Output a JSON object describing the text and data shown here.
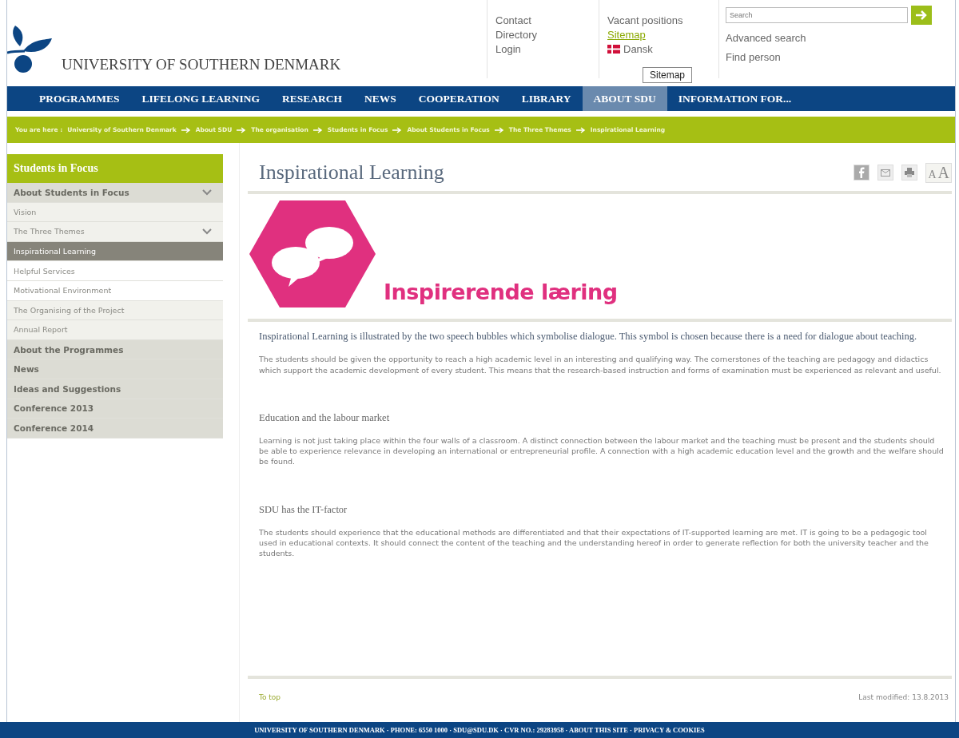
{
  "header": {
    "logo_text": "UNIVERSITY OF SOUTHERN DENMARK",
    "links_1": [
      "Contact",
      "Directory",
      "Login"
    ],
    "links_2": [
      {
        "label": "Vacant positions",
        "hover": false
      },
      {
        "label": "Sitemap",
        "hover": true
      }
    ],
    "language": "Dansk",
    "tooltip": "Sitemap",
    "search": {
      "placeholder": "Search"
    },
    "links_3": [
      "Advanced search",
      "Find person"
    ]
  },
  "nav": [
    {
      "label": "PROGRAMMES",
      "selected": false
    },
    {
      "label": "LIFELONG LEARNING",
      "selected": false
    },
    {
      "label": "RESEARCH",
      "selected": false
    },
    {
      "label": "NEWS",
      "selected": false
    },
    {
      "label": "COOPERATION",
      "selected": false
    },
    {
      "label": "LIBRARY",
      "selected": false
    },
    {
      "label": "ABOUT SDU",
      "selected": true
    },
    {
      "label": "INFORMATION FOR...",
      "selected": false
    }
  ],
  "breadcrumb": {
    "label": "You are here :",
    "items": [
      "University of Southern Denmark",
      "About SDU",
      "The organisation",
      "Students in Focus",
      "About Students in Focus",
      "The Three Themes",
      "Inspirational Learning"
    ]
  },
  "sidebar": {
    "title": "Students in Focus",
    "items": [
      {
        "label": "About Students in Focus",
        "kind": "section",
        "expanded": true,
        "selected": false
      },
      {
        "label": "Vision",
        "kind": "sub",
        "expanded": false,
        "selected": false
      },
      {
        "label": "The Three Themes",
        "kind": "sub",
        "expanded": true,
        "selected": false
      },
      {
        "label": "Inspirational Learning",
        "kind": "subsub",
        "expanded": false,
        "selected": true
      },
      {
        "label": "Helpful Services",
        "kind": "subsub",
        "expanded": false,
        "selected": false
      },
      {
        "label": "Motivational Environment",
        "kind": "subsub",
        "expanded": false,
        "selected": false
      },
      {
        "label": "The Organising of the Project",
        "kind": "sub",
        "expanded": false,
        "selected": false
      },
      {
        "label": "Annual Report",
        "kind": "sub",
        "expanded": false,
        "selected": false
      },
      {
        "label": "About the Programmes",
        "kind": "section",
        "expanded": false,
        "selected": false
      },
      {
        "label": "News",
        "kind": "section",
        "expanded": false,
        "selected": false
      },
      {
        "label": "Ideas and Suggestions",
        "kind": "section",
        "expanded": false,
        "selected": false
      },
      {
        "label": "Conference 2013",
        "kind": "section",
        "expanded": false,
        "selected": false
      },
      {
        "label": "Conference 2014",
        "kind": "section",
        "expanded": false,
        "selected": false
      }
    ]
  },
  "content": {
    "title": "Inspirational Learning",
    "font_sizes": [
      "A",
      "A"
    ],
    "banner_text": "Inspirerende læring",
    "intro": "Inspirational Learning is illustrated by the two speech bubbles which symbolise dialogue. This symbol is chosen because there is a need for dialogue about teaching.",
    "paragraph": "The students should be given the opportunity to reach a high academic level in an interesting and qualifying way. The cornerstones of the teaching are pedagogy and didactics which support the academic development of every student. This means that the research-based instruction and forms of examination must be experienced as relevant and useful.",
    "sections": [
      {
        "heading": "Education and the labour market",
        "text": "Learning is not just taking place within the four walls of a classroom. A distinct connection between the labour market and the teaching must be present and the students should be able to experience relevance in developing an international or entrepreneurial profile. A connection with a high academic education level and the growth and the welfare should be found."
      },
      {
        "heading": "SDU has the IT-factor",
        "text": "The students should experience that the educational methods are differentiated and that their expectations of IT-supported learning are met. IT is going to be a pedagogic tool used in educational contexts. It should connect the content of the teaching and the understanding hereof in order to generate reflection for both the university teacher and the students."
      }
    ],
    "to_top": "To top",
    "last_modified": "Last modified: 13.8.2013"
  },
  "footer": "UNIVERSITY OF SOUTHERN DENMARK · PHONE: 6550 1000 · SDU@SDU.DK · CVR NO.: 29283958 · ABOUT THIS SITE · PRIVACY & COOKIES"
}
